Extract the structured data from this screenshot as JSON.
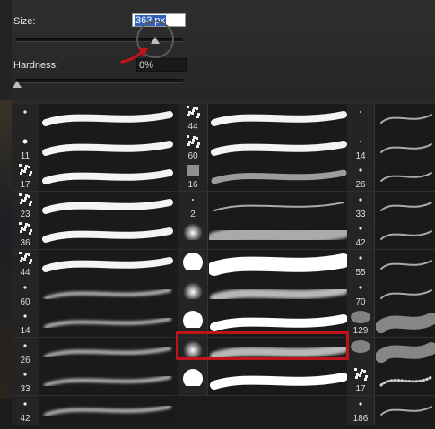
{
  "size": {
    "label": "Size:",
    "value": "363 px",
    "slider_fraction": 0.75
  },
  "hardness": {
    "label": "Hardness:",
    "value": "0%",
    "slider_fraction": 0.0
  },
  "columns": [
    {
      "brushes": [
        {
          "size": "",
          "thumb": "dot-small",
          "preview": "stroke-hard"
        },
        {
          "size": "11",
          "thumb": "dot",
          "preview": "stroke-hard"
        },
        {
          "size": "17",
          "thumb": "splatter",
          "preview": "stroke-hard"
        },
        {
          "size": "23",
          "thumb": "splatter",
          "preview": "stroke-hard"
        },
        {
          "size": "36",
          "thumb": "splatter",
          "preview": "stroke-hard"
        },
        {
          "size": "44",
          "thumb": "splatter",
          "preview": "stroke-hard"
        },
        {
          "size": "60",
          "thumb": "dot-small",
          "preview": "stroke-soft"
        },
        {
          "size": "14",
          "thumb": "dot-small",
          "preview": "stroke-soft"
        },
        {
          "size": "26",
          "thumb": "dot-small",
          "preview": "stroke-soft"
        },
        {
          "size": "33",
          "thumb": "dot-small",
          "preview": "stroke-soft"
        },
        {
          "size": "42",
          "thumb": "dot-small",
          "preview": "stroke-soft"
        }
      ]
    },
    {
      "brushes": [
        {
          "size": "44",
          "thumb": "splatter",
          "preview": "stroke-hard"
        },
        {
          "size": "60",
          "thumb": "splatter",
          "preview": "stroke-hard"
        },
        {
          "size": "16",
          "thumb": "texture",
          "preview": "stroke-rough"
        },
        {
          "size": "2",
          "thumb": "dot-tiny",
          "preview": "stroke-thin"
        },
        {
          "size": "",
          "thumb": "soft-round",
          "preview": "stroke-soft-wide"
        },
        {
          "size": "",
          "thumb": "hard-round",
          "preview": "stroke-hard-wide"
        },
        {
          "size": "",
          "thumb": "soft-round",
          "preview": "stroke-soft-taper"
        },
        {
          "size": "",
          "thumb": "hard-round",
          "preview": "stroke-hard-taper"
        },
        {
          "size": "",
          "thumb": "soft-round",
          "preview": "stroke-soft-taper",
          "selected": true
        },
        {
          "size": "",
          "thumb": "hard-round",
          "preview": "stroke-hard-taper"
        }
      ]
    },
    {
      "brushes": [
        {
          "size": "",
          "thumb": "dot-tiny",
          "preview": "stroke-thin"
        },
        {
          "size": "14",
          "thumb": "dot-tiny",
          "preview": "stroke-thin"
        },
        {
          "size": "26",
          "thumb": "dot-small",
          "preview": "stroke-thin"
        },
        {
          "size": "33",
          "thumb": "dot-small",
          "preview": "stroke-thin"
        },
        {
          "size": "42",
          "thumb": "dot-small",
          "preview": "stroke-thin"
        },
        {
          "size": "55",
          "thumb": "dot-small",
          "preview": "stroke-thin"
        },
        {
          "size": "70",
          "thumb": "dot-small",
          "preview": "stroke-thin"
        },
        {
          "size": "129",
          "thumb": "cloud",
          "preview": "stroke-cloud"
        },
        {
          "size": "",
          "thumb": "cloud",
          "preview": "stroke-cloud"
        },
        {
          "size": "17",
          "thumb": "splatter",
          "preview": "stroke-dots"
        },
        {
          "size": "186",
          "thumb": "dot-small",
          "preview": "stroke-thin"
        }
      ]
    }
  ],
  "colors": {
    "selection": "#c0141a",
    "arrow": "#c0141a",
    "field_highlight": "#2f5fb8"
  }
}
